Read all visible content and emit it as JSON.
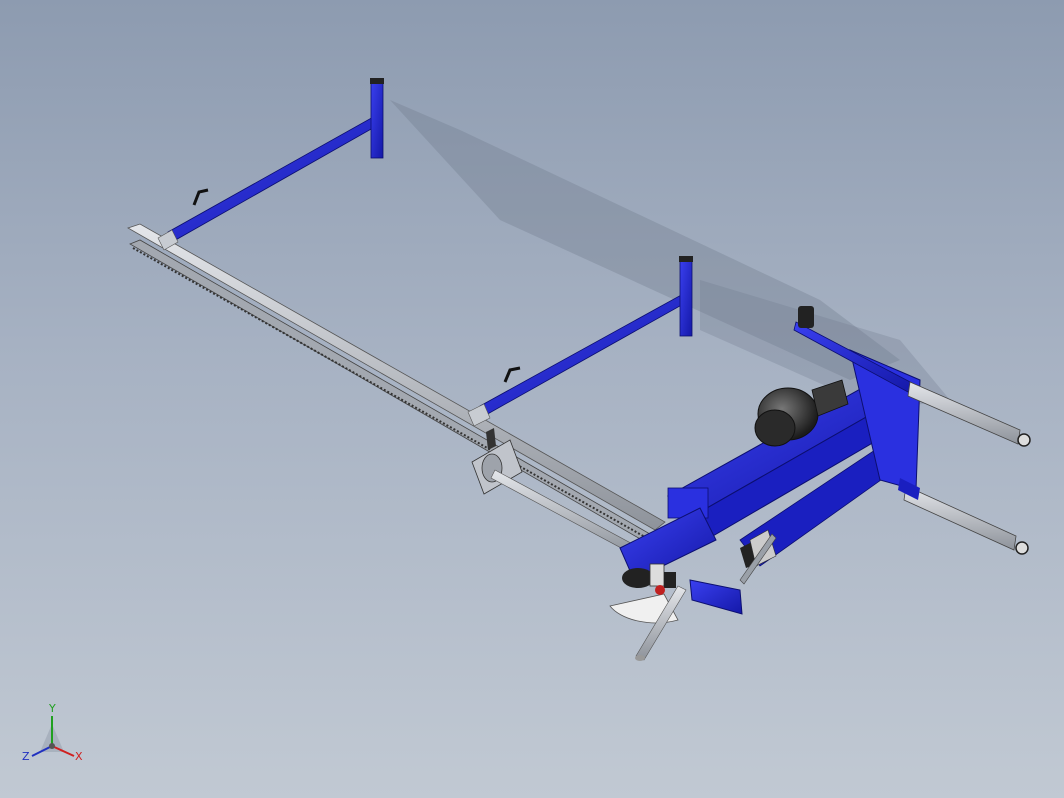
{
  "viewport": {
    "background_top": "#8d9bb0",
    "background_bottom": "#c1c9d3",
    "part_color": "#1f25d6",
    "steel_color": "#b8bcc4"
  },
  "triad": {
    "x_label": "X",
    "y_label": "Y",
    "z_label": "Z",
    "x_color": "#d02020",
    "y_color": "#20a020",
    "z_color": "#2030c0"
  }
}
